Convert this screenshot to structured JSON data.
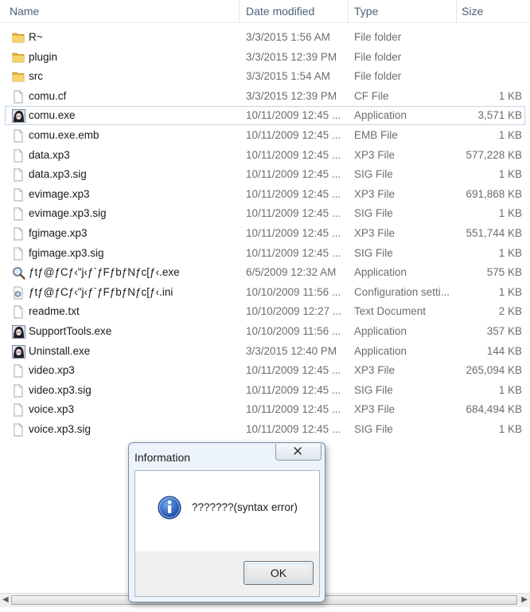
{
  "columns": {
    "name": "Name",
    "date": "Date modified",
    "type": "Type",
    "size": "Size"
  },
  "files": [
    {
      "name": "R~",
      "date": "3/3/2015 1:56 AM",
      "type": "File folder",
      "size": "",
      "icon": "folder-icon"
    },
    {
      "name": "plugin",
      "date": "3/3/2015 12:39 PM",
      "type": "File folder",
      "size": "",
      "icon": "folder-icon"
    },
    {
      "name": "src",
      "date": "3/3/2015 1:54 AM",
      "type": "File folder",
      "size": "",
      "icon": "folder-icon"
    },
    {
      "name": "comu.cf",
      "date": "3/3/2015 12:39 PM",
      "type": "CF File",
      "size": "1 KB",
      "icon": "file-icon"
    },
    {
      "name": "comu.exe",
      "date": "10/11/2009 12:45 ...",
      "type": "Application",
      "size": "3,571 KB",
      "icon": "app-character-icon",
      "selected": true
    },
    {
      "name": "comu.exe.emb",
      "date": "10/11/2009 12:45 ...",
      "type": "EMB File",
      "size": "1 KB",
      "icon": "file-icon"
    },
    {
      "name": "data.xp3",
      "date": "10/11/2009 12:45 ...",
      "type": "XP3 File",
      "size": "577,228 KB",
      "icon": "file-icon"
    },
    {
      "name": "data.xp3.sig",
      "date": "10/11/2009 12:45 ...",
      "type": "SIG File",
      "size": "1 KB",
      "icon": "file-icon"
    },
    {
      "name": "evimage.xp3",
      "date": "10/11/2009 12:45 ...",
      "type": "XP3 File",
      "size": "691,868 KB",
      "icon": "file-icon"
    },
    {
      "name": "evimage.xp3.sig",
      "date": "10/11/2009 12:45 ...",
      "type": "SIG File",
      "size": "1 KB",
      "icon": "file-icon"
    },
    {
      "name": "fgimage.xp3",
      "date": "10/11/2009 12:45 ...",
      "type": "XP3 File",
      "size": "551,744 KB",
      "icon": "file-icon"
    },
    {
      "name": "fgimage.xp3.sig",
      "date": "10/11/2009 12:45 ...",
      "type": "SIG File",
      "size": "1 KB",
      "icon": "file-icon"
    },
    {
      "name": "ƒtƒ@ƒCƒ‹\"j‹ƒ`ƒFƒbƒNƒc[ƒ‹.exe",
      "date": "6/5/2009 12:32 AM",
      "type": "Application",
      "size": "575 KB",
      "icon": "magnifier-app-icon"
    },
    {
      "name": "ƒtƒ@ƒCƒ‹\"j‹ƒ`ƒFƒbƒNƒc[ƒ‹.ini",
      "date": "10/10/2009 11:56 ...",
      "type": "Configuration setti...",
      "size": "1 KB",
      "icon": "settings-file-icon"
    },
    {
      "name": "readme.txt",
      "date": "10/10/2009 12:27 ...",
      "type": "Text Document",
      "size": "2 KB",
      "icon": "file-icon"
    },
    {
      "name": "SupportTools.exe",
      "date": "10/10/2009 11:56 ...",
      "type": "Application",
      "size": "357 KB",
      "icon": "app-character-icon"
    },
    {
      "name": "Uninstall.exe",
      "date": "3/3/2015 12:40 PM",
      "type": "Application",
      "size": "144 KB",
      "icon": "app-character-icon"
    },
    {
      "name": "video.xp3",
      "date": "10/11/2009 12:45 ...",
      "type": "XP3 File",
      "size": "265,094 KB",
      "icon": "file-icon"
    },
    {
      "name": "video.xp3.sig",
      "date": "10/11/2009 12:45 ...",
      "type": "SIG File",
      "size": "1 KB",
      "icon": "file-icon"
    },
    {
      "name": "voice.xp3",
      "date": "10/11/2009 12:45 ...",
      "type": "XP3 File",
      "size": "684,494 KB",
      "icon": "file-icon"
    },
    {
      "name": "voice.xp3.sig",
      "date": "10/11/2009 12:45 ...",
      "type": "SIG File",
      "size": "1 KB",
      "icon": "file-icon"
    }
  ],
  "dialog": {
    "title": "Information",
    "message": "???????(syntax error)",
    "ok_label": "OK",
    "icon": "info-icon",
    "close_icon": "close-icon"
  },
  "colors": {
    "accent": "#1e63c0",
    "selection_border": "#c5d3e6",
    "dialog_bg": "#ecf3fb"
  }
}
